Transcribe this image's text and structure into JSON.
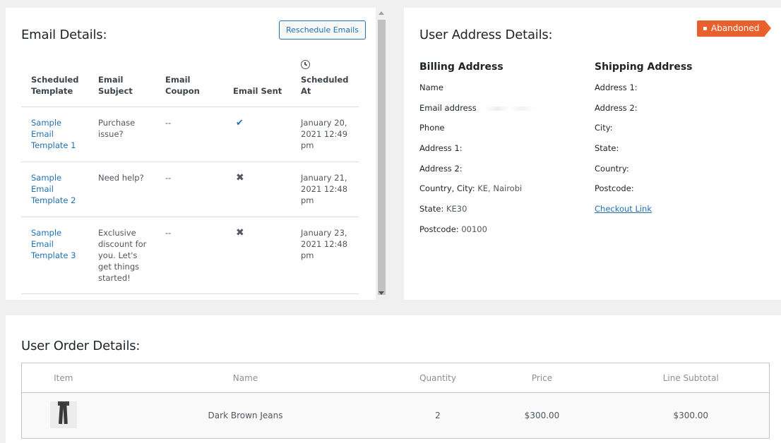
{
  "email_details": {
    "title": "Email Details:",
    "reschedule_label": "Reschedule Emails",
    "columns": [
      "Scheduled Template",
      "Email Subject",
      "Email Coupon",
      "Email Sent",
      "Scheduled At"
    ],
    "rows": [
      {
        "template": "Sample Email Template 1",
        "subject": "Purchase issue?",
        "coupon": "--",
        "sent": "✔",
        "sent_status": "sent",
        "scheduled_at": "January 20, 2021 12:49 pm"
      },
      {
        "template": "Sample Email Template 2",
        "subject": "Need help?",
        "coupon": "--",
        "sent": "✖",
        "sent_status": "not-sent",
        "scheduled_at": "January 21, 2021 12:48 pm"
      },
      {
        "template": "Sample Email Template 3",
        "subject": "Exclusive discount for you. Let's get things started!",
        "coupon": "--",
        "sent": "✖",
        "sent_status": "not-sent",
        "scheduled_at": "January 23, 2021 12:48 pm"
      }
    ]
  },
  "address_details": {
    "title": "User Address Details:",
    "status_badge": "Abandoned",
    "status_color": "#e8602c",
    "billing": {
      "heading": "Billing Address",
      "name_label": "Name",
      "email_label": "Email address",
      "phone_label": "Phone",
      "address1_label": "Address 1:",
      "address2_label": "Address 2:",
      "country_city_label": "Country, City:",
      "country_city_value": "KE, Nairobi",
      "state_label": "State:",
      "state_value": "KE30",
      "postcode_label": "Postcode:",
      "postcode_value": "00100"
    },
    "shipping": {
      "heading": "Shipping Address",
      "address1_label": "Address 1:",
      "address2_label": "Address 2:",
      "city_label": "City:",
      "state_label": "State:",
      "country_label": "Country:",
      "postcode_label": "Postcode:",
      "checkout_link": "Checkout Link"
    }
  },
  "order_details": {
    "title": "User Order Details:",
    "columns": [
      "Item",
      "Name",
      "Quantity",
      "Price",
      "Line Subtotal"
    ],
    "rows": [
      {
        "item_image": "jeans-thumbnail",
        "name": "Dark Brown Jeans",
        "quantity": "2",
        "price": "$300.00",
        "line_subtotal": "$300.00"
      }
    ]
  },
  "colors": {
    "link": "#2271b1",
    "badge": "#e8602c",
    "background": "#f0f0f1"
  }
}
